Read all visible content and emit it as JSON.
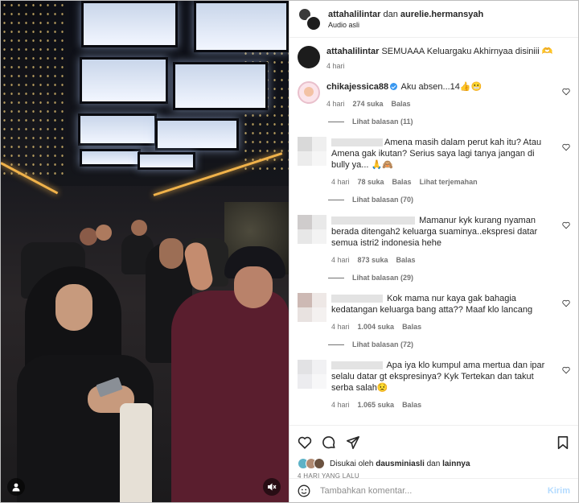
{
  "header": {
    "user1": "attahalilintar",
    "and": "dan",
    "user2": "aurelie.hermansyah",
    "audio": "Audio asli"
  },
  "caption": {
    "username": "attahalilintar",
    "text": "SEMUAAA Keluargaku Akhirnyaa disiniii 🫶",
    "time": "4 hari"
  },
  "comments": [
    {
      "username": "chikajessica88",
      "verified": true,
      "text": "Aku absen...14👍😬",
      "time": "4 hari",
      "likes": "274 suka",
      "reply": "Balas",
      "translate": "",
      "view_replies": "Lihat balasan (11)"
    },
    {
      "username": "",
      "text": "Amena masih dalam perut kah itu? Atau Amena gak ikutan? Serius saya lagi tanya jangan di bully ya... 🙏🙈",
      "time": "4 hari",
      "likes": "78 suka",
      "reply": "Balas",
      "translate": "Lihat terjemahan",
      "view_replies": "Lihat balasan (70)"
    },
    {
      "username": "",
      "text": "Mamanur kyk kurang nyaman berada ditengah2 keluarga suaminya..ekspresi datar semua istri2 indonesia hehe",
      "time": "4 hari",
      "likes": "873 suka",
      "reply": "Balas",
      "translate": "",
      "view_replies": "Lihat balasan (29)"
    },
    {
      "username": "",
      "text": "Kok mama nur kaya gak bahagia kedatangan keluarga bang atta?? Maaf klo lancang",
      "time": "4 hari",
      "likes": "1.004 suka",
      "reply": "Balas",
      "translate": "",
      "view_replies": "Lihat balasan (72)"
    },
    {
      "username": "",
      "text": "Apa iya klo kumpul ama mertua dan ipar selalu datar gt ekspresinya? Kyk Tertekan dan takut serba salah😟",
      "time": "4 hari",
      "likes": "1.065 suka",
      "reply": "Balas",
      "translate": "",
      "view_replies": ""
    }
  ],
  "liked_by": {
    "prefix": "Disukai oleh",
    "user": "dausminiasli",
    "and": "dan",
    "others": "lainnya"
  },
  "posted": "4 HARI YANG LALU",
  "add_comment": {
    "placeholder": "Tambahkan komentar...",
    "send": "Kirim"
  },
  "colors": {
    "verified": "#3897f0",
    "send_disabled": "#b3dbff",
    "muted": "#737373"
  }
}
